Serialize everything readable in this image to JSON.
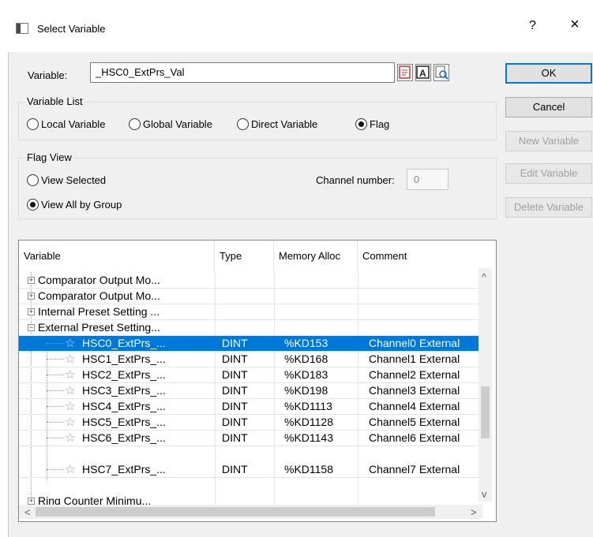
{
  "window": {
    "title": "Select Variable",
    "help": "?",
    "close": "×"
  },
  "variable": {
    "label": "Variable:",
    "value": "_HSC0_ExtPrs_Val"
  },
  "variable_list": {
    "title": "Variable List",
    "options": [
      "Local Variable",
      "Global Variable",
      "Direct Variable",
      "Flag"
    ],
    "selected": "Flag"
  },
  "flag_view": {
    "title": "Flag View",
    "options": [
      "View Selected",
      "View All by Group"
    ],
    "selected": "View All by Group",
    "channel_label": "Channel number:",
    "channel_value": "0"
  },
  "buttons": {
    "ok": "OK",
    "cancel": "Cancel",
    "new_variable": "New Variable",
    "edit_variable": "Edit Variable",
    "delete_variable": "Delete Variable"
  },
  "table": {
    "columns": [
      "Variable",
      "Type",
      "Memory Alloc",
      "Comment"
    ],
    "groups": [
      {
        "label": "Comparator Output Mo...",
        "expanded": false
      },
      {
        "label": "Comparator Output Mo...",
        "expanded": false
      },
      {
        "label": "Internal Preset Setting ...",
        "expanded": false
      },
      {
        "label": "External Preset Setting...",
        "expanded": true
      }
    ],
    "rows": [
      {
        "name": "HSC0_ExtPrs_...",
        "type": "DINT",
        "mem": "%KD153",
        "comment": "Channel0 External",
        "selected": true
      },
      {
        "name": "HSC1_ExtPrs_...",
        "type": "DINT",
        "mem": "%KD168",
        "comment": "Channel1 External",
        "selected": false
      },
      {
        "name": "HSC2_ExtPrs_...",
        "type": "DINT",
        "mem": "%KD183",
        "comment": "Channel2 External",
        "selected": false
      },
      {
        "name": "HSC3_ExtPrs_...",
        "type": "DINT",
        "mem": "%KD198",
        "comment": "Channel3 External",
        "selected": false
      },
      {
        "name": "HSC4_ExtPrs_...",
        "type": "DINT",
        "mem": "%KD1113",
        "comment": "Channel4 External",
        "selected": false
      },
      {
        "name": "HSC5_ExtPrs_...",
        "type": "DINT",
        "mem": "%KD1128",
        "comment": "Channel5 External",
        "selected": false
      },
      {
        "name": "HSC6_ExtPrs_...",
        "type": "DINT",
        "mem": "%KD1143",
        "comment": "Channel6 External",
        "selected": false
      },
      {
        "name": "HSC7_ExtPrs_...",
        "type": "DINT",
        "mem": "%KD1158",
        "comment": "Channel7 External",
        "selected": false
      }
    ],
    "last_group": {
      "label": "Ring Counter Minimu...",
      "expanded": false
    }
  },
  "icons": [
    "window-icon",
    "variable-list-icon",
    "variable-text-icon",
    "variable-search-icon",
    "star-icon",
    "expand-icon",
    "collapse-icon"
  ],
  "colors": {
    "selection": "#0078d7",
    "default_button_border": "#0078d7",
    "dialog_bg": "#f0f0f0"
  }
}
